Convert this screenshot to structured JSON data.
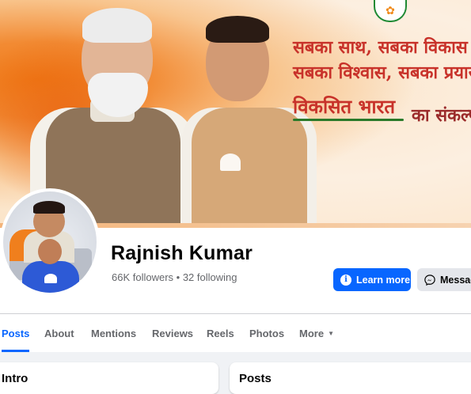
{
  "cover": {
    "slogan_line1": "सबका साथ, सबका विकास",
    "slogan_line2": "सबका विश्वास, सबका प्रयास",
    "slogan_line3": "विकसित भारत",
    "slogan_line3b": "का संकल्प",
    "party_logo_icon": "lotus-icon"
  },
  "profile": {
    "name": "Rajnish Kumar",
    "stats": "66K followers • 32 following"
  },
  "actions": {
    "learn_more_label": "Learn more",
    "message_label": "Message"
  },
  "tabs": {
    "items": [
      "Posts",
      "About",
      "Mentions",
      "Reviews",
      "Reels",
      "Photos",
      "More"
    ],
    "active": "Posts"
  },
  "sections": {
    "intro_title": "Intro",
    "posts_title": "Posts"
  },
  "colors": {
    "accent": "#0866ff",
    "secondary_button": "#e4e6eb",
    "page_background": "#f0f2f5",
    "cover_saffron": "#f07a17",
    "slogan_red": "#c8322a"
  }
}
